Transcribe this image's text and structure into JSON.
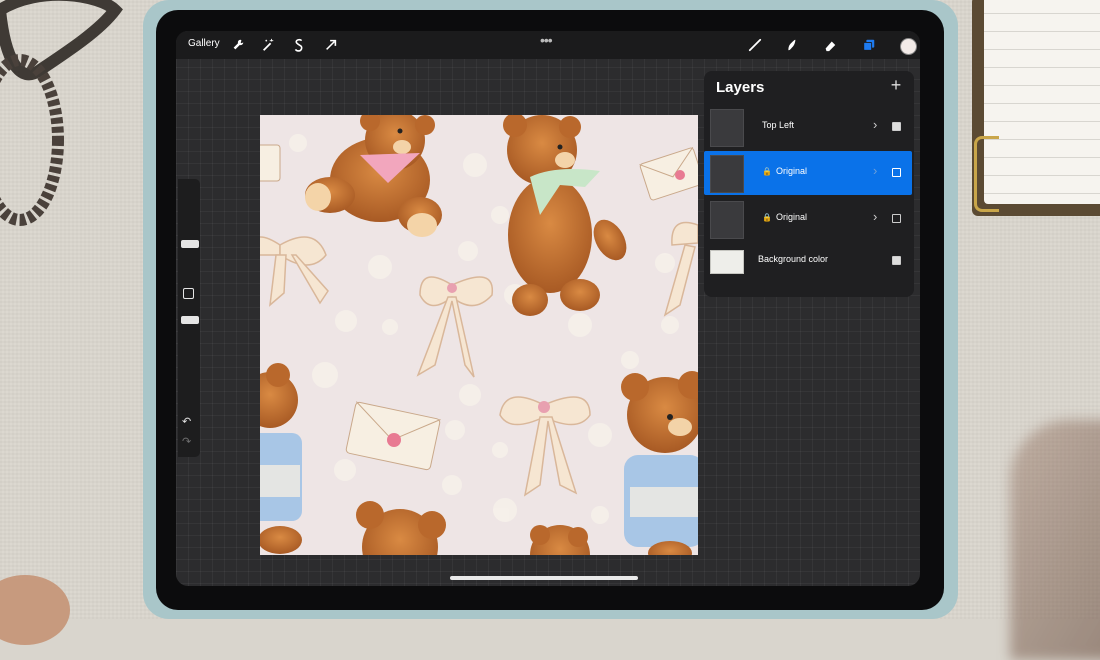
{
  "toolbar": {
    "gallery_label": "Gallery",
    "left_icons": [
      "wrench-icon",
      "magic-wand-icon",
      "selection-icon",
      "transform-arrow-icon"
    ],
    "more_label": "•••",
    "right_icons": [
      "brush-icon",
      "smudge-icon",
      "eraser-icon",
      "layers-icon"
    ],
    "current_color": "#f3ebe8"
  },
  "sidebar": {
    "undo_glyph": "↶",
    "redo_glyph": "↷"
  },
  "layers_panel": {
    "title": "Layers",
    "add_label": "+",
    "items": [
      {
        "name": "Top Left",
        "locked": false,
        "active": false,
        "visible": true
      },
      {
        "name": "Original",
        "locked": true,
        "active": true,
        "visible": false
      },
      {
        "name": "Original",
        "locked": true,
        "active": false,
        "visible": false
      },
      {
        "name": "Background color",
        "locked": false,
        "active": false,
        "visible": true
      }
    ],
    "accent_color": "#0a72e9"
  },
  "canvas": {
    "background": "#eee5e5"
  }
}
